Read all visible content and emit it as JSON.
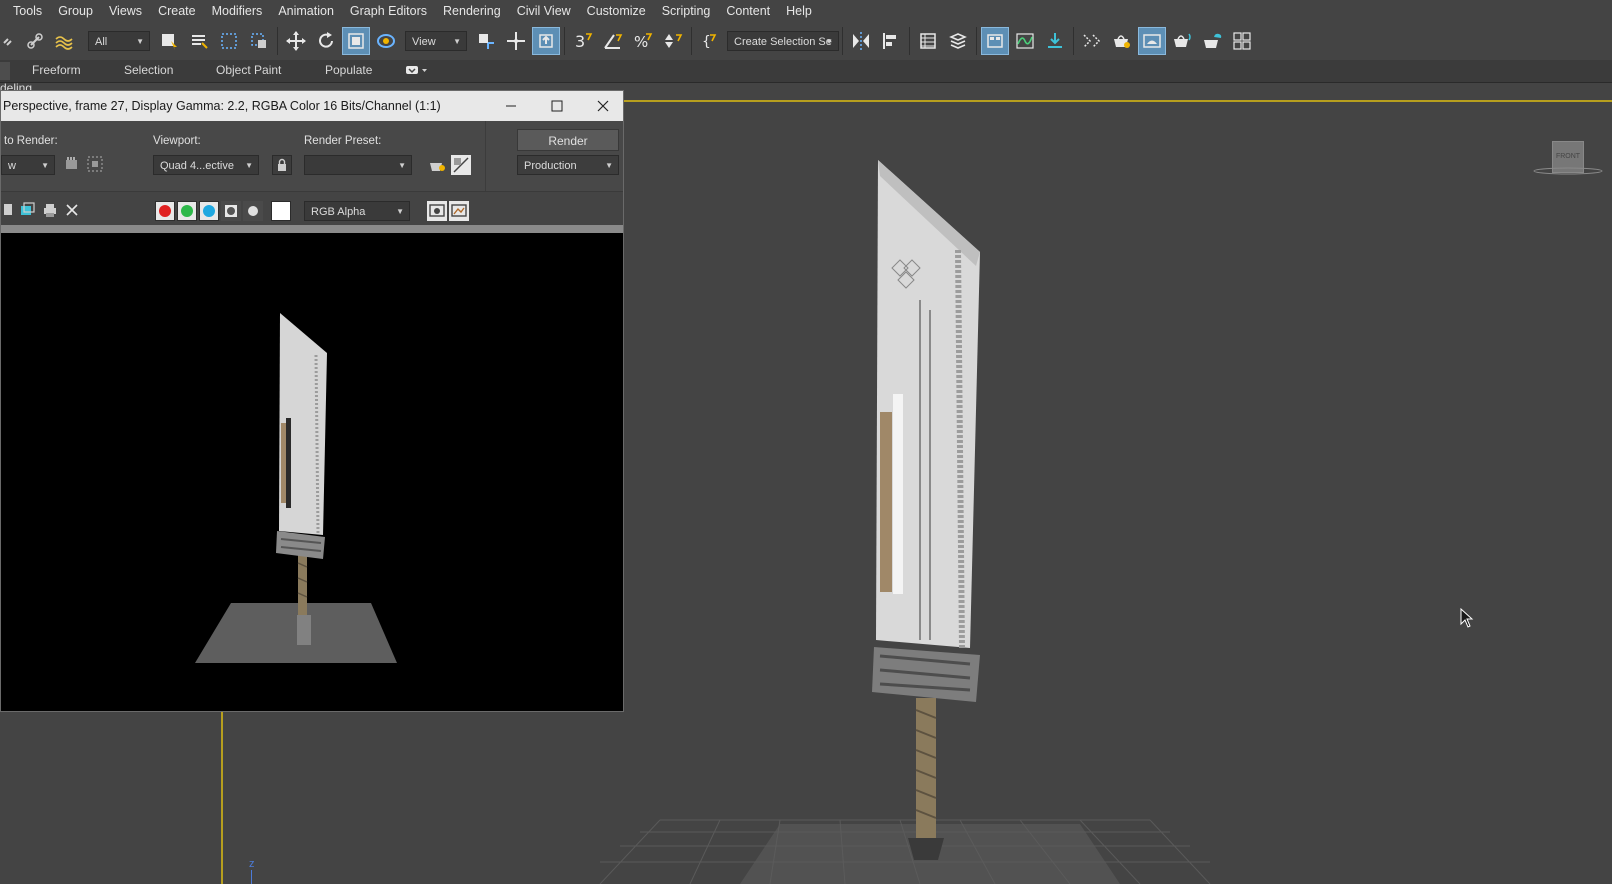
{
  "menu": [
    "Tools",
    "Group",
    "Views",
    "Create",
    "Modifiers",
    "Animation",
    "Graph Editors",
    "Rendering",
    "Civil View",
    "Customize",
    "Scripting",
    "Content",
    "Help"
  ],
  "toolbar": {
    "filter_value": "All",
    "refcoord_value": "View",
    "selection_set_value": "Create Selection Se"
  },
  "ribbon": {
    "tabs": [
      "Freeform",
      "Selection",
      "Object Paint",
      "Populate"
    ],
    "partial_label": "deling"
  },
  "render_window": {
    "title": "Perspective, frame 27, Display Gamma: 2.2, RGBA Color 16 Bits/Channel (1:1)",
    "area_label": "to Render:",
    "area_value": "w",
    "viewport_label": "Viewport:",
    "viewport_value": "Quad 4...ective",
    "preset_label": "Render Preset:",
    "preset_value": "",
    "render_button": "Render",
    "production_value": "Production",
    "channel_value": "RGB Alpha"
  },
  "viewcube_label": "FRONT",
  "axis_label": "z",
  "colors": {
    "accent_blue": "#5d8fb5",
    "viewport_border": "#b79f1e",
    "red": "#e02020",
    "green": "#2db84a",
    "blue": "#1fa8e0"
  }
}
